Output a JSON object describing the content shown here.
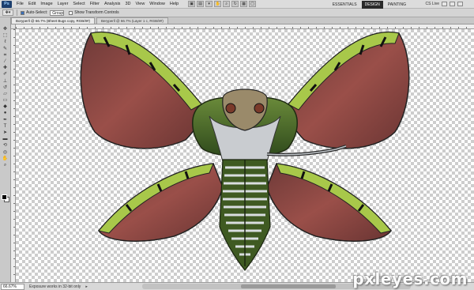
{
  "menubar": {
    "logo": "Ps",
    "items": [
      "File",
      "Edit",
      "Image",
      "Layer",
      "Select",
      "Filter",
      "Analysis",
      "3D",
      "View",
      "Window",
      "Help"
    ],
    "workspaces": [
      "ESSENTIALS",
      "DESIGN",
      "PAINTING"
    ],
    "active_workspace": "DESIGN",
    "cslive": "CS Live"
  },
  "options": {
    "auto_select_label": "Auto-Select:",
    "auto_select_value": "Group",
    "show_transform_label": "Show Transform Controls"
  },
  "doc_tabs": [
    {
      "label": "Boryperll @ 66.7% (Bheet Bugs copy, RGB/8#)"
    },
    {
      "label": "Beryperll @ 66.7% (Layer 1 c, RGB/8#)"
    }
  ],
  "status": {
    "zoom": "66.67%",
    "message": "Exposure works in 32-bit only"
  },
  "watermark": "pxleyes.com",
  "colors": {
    "wing_red": "#8d4a45",
    "wing_green": "#a8c84a",
    "body_green": "#4b6b2a",
    "foreground": "#000000",
    "background": "#ffffff"
  }
}
